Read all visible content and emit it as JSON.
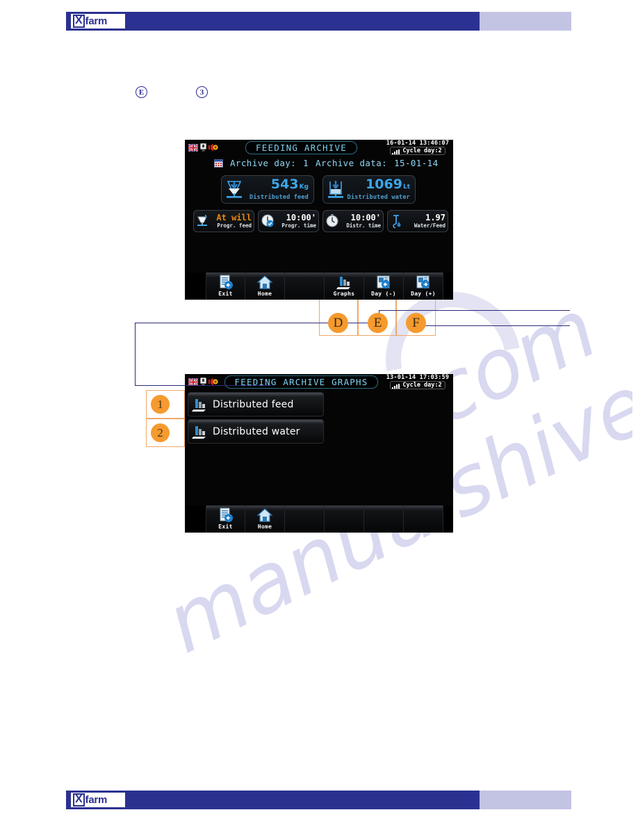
{
  "brand": {
    "logo_x": "X",
    "logo_word": "farm"
  },
  "markers": {
    "top_left_letter": "E",
    "top_right_number": "3"
  },
  "screen1": {
    "name": "feeding-archive",
    "status": {
      "title": "FEEDING ARCHIVE",
      "datetime": "16-01-14  13:46:07",
      "cycle": "Cycle day:2",
      "icons": [
        "uk-flag-icon",
        "usb-icon",
        "alarm-icon"
      ]
    },
    "archive": {
      "day_label": "Archive day:",
      "day_value": "1",
      "data_label": "Archive data:",
      "data_value": "15-01-14"
    },
    "totals": [
      {
        "icon": "feed-hopper-icon",
        "value": "543",
        "unit": "Kg",
        "label": "Distributed feed"
      },
      {
        "icon": "water-tank-icon",
        "value": "1069",
        "unit": "Lt",
        "label": "Distributed water"
      }
    ],
    "stats": [
      {
        "icon": "feeder-bowl-icon",
        "value": "At will",
        "label": "Progr. feed",
        "accent": "#e8870f"
      },
      {
        "icon": "clock-check-icon",
        "value": "10:00'",
        "label": "Progr. time",
        "accent": "#ffffff"
      },
      {
        "icon": "stopwatch-icon",
        "value": "10:00'",
        "label": "Distr. time",
        "accent": "#ffffff"
      },
      {
        "icon": "water-feed-ratio-icon",
        "value": "1.97",
        "label": "Water/Feed",
        "accent": "#ffffff"
      }
    ],
    "toolbar": [
      {
        "icon": "exit-icon",
        "label": "Exit"
      },
      {
        "icon": "home-icon",
        "label": "Home"
      },
      {
        "icon": "",
        "label": ""
      },
      {
        "icon": "graphs-icon",
        "label": "Graphs"
      },
      {
        "icon": "day-minus-icon",
        "label": "Day (-)"
      },
      {
        "icon": "day-plus-icon",
        "label": "Day (+)"
      }
    ]
  },
  "screen2": {
    "name": "feeding-archive-graphs",
    "status": {
      "title": "FEEDING ARCHIVE GRAPHS",
      "datetime": "13-01-14  17:03:59",
      "cycle": "Cycle day:2",
      "icons": [
        "uk-flag-icon",
        "usb-icon",
        "alarm-icon"
      ]
    },
    "menu": [
      {
        "icon": "bar-chart-icon",
        "label": "Distributed feed"
      },
      {
        "icon": "bar-chart-icon",
        "label": "Distributed water"
      }
    ],
    "toolbar": [
      {
        "icon": "exit-icon",
        "label": "Exit"
      },
      {
        "icon": "home-icon",
        "label": "Home"
      },
      {
        "icon": "",
        "label": ""
      },
      {
        "icon": "",
        "label": ""
      },
      {
        "icon": "",
        "label": ""
      },
      {
        "icon": "",
        "label": ""
      }
    ]
  },
  "callouts": {
    "letters": [
      "D",
      "E",
      "F"
    ],
    "numbers": [
      "1",
      "2"
    ]
  },
  "watermark": {
    "line1": "manualshive",
    "line2": "e.com"
  },
  "colors": {
    "brand_dark": "#2b3191",
    "brand_light": "#c3c3e3",
    "callout_orange": "#f59a2e",
    "screen_cyan": "#7fd2f2",
    "value_blue": "#3ea6e8",
    "accent_orange": "#e8870f",
    "lead_line": "#2b2b7a"
  }
}
